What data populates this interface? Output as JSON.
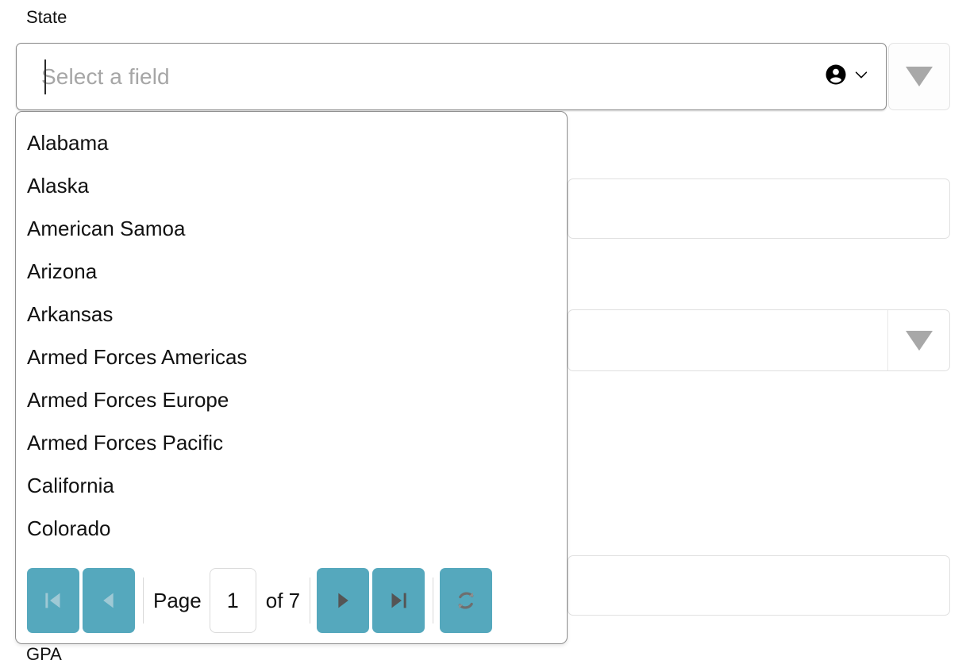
{
  "form": {
    "fields": [
      {
        "label": "State",
        "placeholder": "Select a field",
        "value": ""
      },
      {
        "label": "GPA",
        "placeholder": "",
        "value": ""
      }
    ],
    "state_label": "State",
    "gpa_label": "GPA",
    "state_placeholder": "Select a field",
    "state_value": ""
  },
  "icons": {
    "account": "account-circle-icon",
    "chevron_down": "chevron-down-icon",
    "dropdown_triangle": "triangle-down-icon",
    "first_page": "first-page-icon",
    "prev_page": "previous-page-icon",
    "next_page": "next-page-icon",
    "last_page": "last-page-icon",
    "refresh": "refresh-icon"
  },
  "dropdown": {
    "open": true,
    "options": [
      "Alabama",
      "Alaska",
      "American Samoa",
      "Arizona",
      "Arkansas",
      "Armed Forces Americas",
      "Armed Forces Europe",
      "Armed Forces Pacific",
      "California",
      "Colorado"
    ]
  },
  "pager": {
    "page_label": "Page",
    "page_value": "1",
    "of_label": "of 7",
    "total_pages": 7,
    "current_page": 1,
    "first_enabled": false,
    "prev_enabled": false,
    "next_enabled": true,
    "last_enabled": true,
    "buttons": {
      "first": "First page",
      "prev": "Previous page",
      "next": "Next page",
      "last": "Last page",
      "refresh": "Refresh"
    }
  },
  "colors": {
    "pager_button": "#55a8bd",
    "glyph_enabled": "#555555",
    "glyph_disabled": "#9fc9d5",
    "popup_border": "#8f8f8f",
    "placeholder_text": "#a6a6a6",
    "text": "#111111",
    "triangle": "#a8a8a8",
    "field_border": "#e0e0e0"
  }
}
